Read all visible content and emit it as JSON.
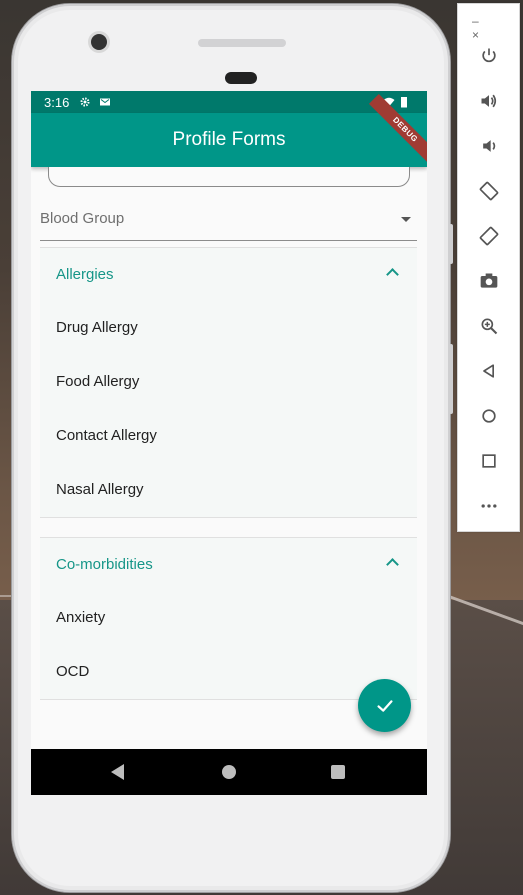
{
  "status_bar": {
    "time": "3:16"
  },
  "app_bar": {
    "title": "Profile Forms",
    "debug_badge": "DEBUG"
  },
  "form": {
    "blood_group": {
      "label": "Blood Group"
    },
    "panels": [
      {
        "title": "Allergies",
        "items": [
          "Drug Allergy",
          "Food Allergy",
          "Contact Allergy",
          "Nasal Allergy"
        ]
      },
      {
        "title": "Co-morbidities",
        "items": [
          "Anxiety",
          "OCD"
        ]
      }
    ]
  },
  "colors": {
    "primary": "#009688",
    "primary_dark": "#00796b",
    "accent_text": "#169688"
  },
  "emulator_toolbar": {
    "minimize": "–",
    "close": "×",
    "buttons": [
      "power-icon",
      "volume-up-icon",
      "volume-down-icon",
      "rotate-left-icon",
      "rotate-right-icon",
      "camera-icon",
      "zoom-icon",
      "back-icon",
      "home-icon",
      "overview-icon",
      "more-icon"
    ]
  }
}
